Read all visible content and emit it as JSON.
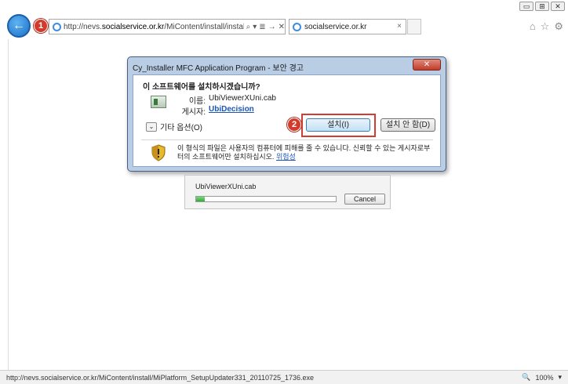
{
  "browser": {
    "window_controls": [
      "▭",
      "⊞",
      "✕"
    ],
    "address": {
      "prefix": "http://nevs.",
      "domain": "socialservice.or.kr",
      "suffix": "/MiContent/install/install.js",
      "icons": [
        "⌕",
        "▾",
        "≣",
        "→",
        "✕"
      ]
    },
    "tab": {
      "title": "socialservice.or.kr",
      "close": "×"
    },
    "toolbar_icons": [
      "⌂",
      "☆",
      "⚙"
    ]
  },
  "callouts": {
    "one": "1",
    "two": "2"
  },
  "dialog": {
    "title": "Cy_Installer MFC Application Program - 보안 경고",
    "close": "✕",
    "question": "이 소프트웨어를 설치하시겠습니까?",
    "name_label": "이름:",
    "name_value": "UbiViewerXUni.cab",
    "publisher_label": "게시자:",
    "publisher_value": "UbiDecision",
    "more_options_icon": "⌄",
    "more_options": "기타 옵션(O)",
    "install_button": "설치(I)",
    "dont_install_button": "설치 안 함(D)",
    "warning_text": "이 형식의 파일은 사용자의 컴퓨터에 피해를 줄 수 있습니다. 신뢰할 수 있는 게시자로부터의 소프트웨어만 설치하십시오.",
    "risk_link": "위험성"
  },
  "download": {
    "filename": "UbiViewerXUni.cab",
    "progress_fraction": 0.06,
    "cancel_button": "Cancel"
  },
  "statusbar": {
    "url": "http://nevs.socialservice.or.kr/MiContent/install/MiPlatform_SetupUpdater331_20110725_1736.exe",
    "zoom": "100%",
    "zoom_icon": "🔍",
    "zoom_dropdown": "▾"
  },
  "colors": {
    "accent": "#1b6fc9",
    "highlight": "#d23c33",
    "dialog_frame": "#b9cde5",
    "progress": "#2fae2f"
  }
}
